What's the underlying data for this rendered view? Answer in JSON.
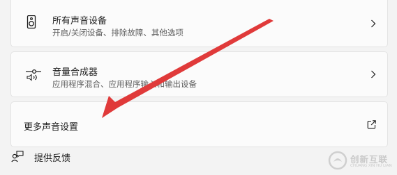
{
  "rows": [
    {
      "title": "所有声音设备",
      "subtitle": "开启/关闭设备、排除故障、其他选项",
      "icon": "speaker-icon",
      "trailing_icon": "chevron-right-icon"
    },
    {
      "title": "音量合成器",
      "subtitle": "应用程序混合、应用程序输入和输出设备",
      "icon": "volume-mixer-icon",
      "trailing_icon": "chevron-right-icon"
    },
    {
      "title": "更多声音设置",
      "trailing_icon": "open-external-icon"
    }
  ],
  "feedback": {
    "label": "提供反馈",
    "icon": "feedback-icon"
  },
  "watermark": {
    "name": "创新互联",
    "subtitle": "CHUANG XIN HU LIAN"
  },
  "colors": {
    "annotation_arrow": "#e03a3a",
    "card_background": "#fbfbfb",
    "page_background": "#f3f3f3"
  }
}
